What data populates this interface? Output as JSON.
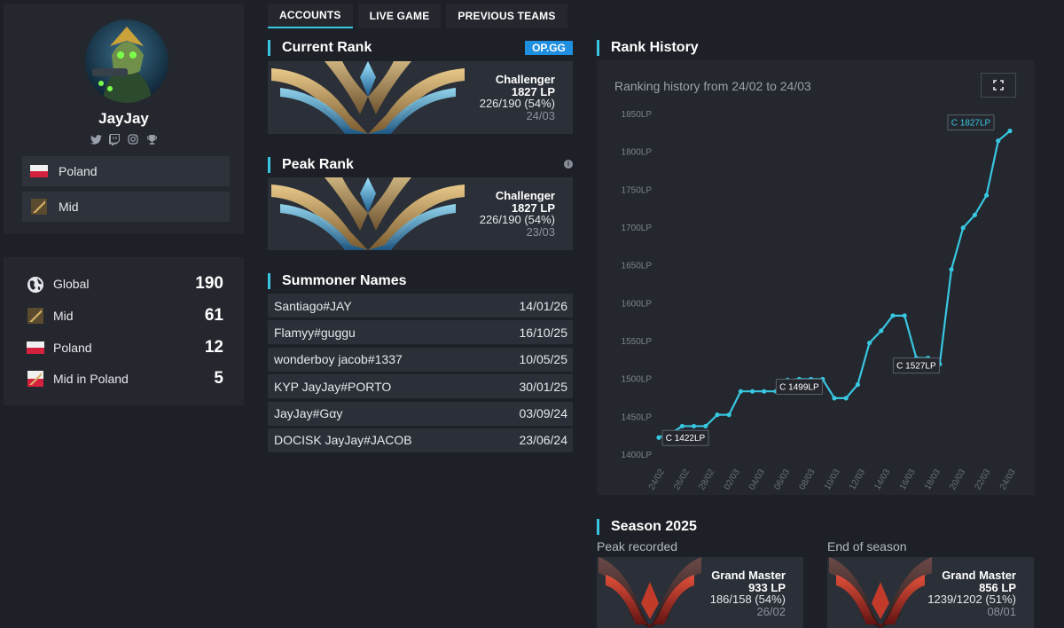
{
  "profile": {
    "name": "JayJay",
    "socials": [
      "twitter-icon",
      "twitch-icon",
      "instagram-icon",
      "trophy-icon"
    ],
    "country": "Poland",
    "role": "Mid"
  },
  "ladder": [
    {
      "label": "Global",
      "value": "190",
      "icon": "globe-icon"
    },
    {
      "label": "Mid",
      "value": "61",
      "icon": "mid-role-icon"
    },
    {
      "label": "Poland",
      "value": "12",
      "icon": "poland-flag-icon"
    },
    {
      "label": "Mid in Poland",
      "value": "5",
      "icon": "mid-poland-icon"
    }
  ],
  "tabs": [
    {
      "label": "ACCOUNTS",
      "active": true
    },
    {
      "label": "LIVE GAME",
      "active": false
    },
    {
      "label": "PREVIOUS TEAMS",
      "active": false
    }
  ],
  "current_rank": {
    "title": "Current Rank",
    "badge": "OP.GG",
    "tier": "Challenger",
    "lp": "1827 LP",
    "winloss": "226/190 (54%)",
    "date": "24/03"
  },
  "peak_rank": {
    "title": "Peak Rank",
    "tier": "Challenger",
    "lp": "1827 LP",
    "winloss": "226/190 (54%)",
    "date": "23/03"
  },
  "summoner_names": {
    "title": "Summoner Names",
    "rows": [
      {
        "name": "Santiago#JAY",
        "date": "14/01/26"
      },
      {
        "name": "Flamyy#guggu",
        "date": "16/10/25"
      },
      {
        "name": "wonderboy jacob#1337",
        "date": "10/05/25"
      },
      {
        "name": "KYP JayJay#PORTO",
        "date": "30/01/25"
      },
      {
        "name": "JayJay#Gαy",
        "date": "03/09/24"
      },
      {
        "name": "DOCISK JayJay#JACOB",
        "date": "23/06/24"
      }
    ]
  },
  "rank_history": {
    "title": "Rank History",
    "caption": "Ranking history from 24/02 to 24/03"
  },
  "chart_data": {
    "type": "line",
    "title": "",
    "xlabel": "",
    "ylabel": "",
    "ylim": [
      1400,
      1850
    ],
    "y_ticks": [
      "1850LP",
      "1800LP",
      "1750LP",
      "1700LP",
      "1650LP",
      "1600LP",
      "1550LP",
      "1500LP",
      "1450LP",
      "1400LP"
    ],
    "x_ticks": [
      "24/02",
      "26/02",
      "28/02",
      "02/03",
      "04/03",
      "06/03",
      "08/03",
      "10/03",
      "12/03",
      "14/03",
      "16/03",
      "18/03",
      "20/03",
      "22/03",
      "24/03"
    ],
    "x_dates": [
      "24/02",
      "24/02",
      "25/02",
      "26/02",
      "27/02",
      "28/02",
      "29/02",
      "01/03",
      "02/03",
      "03/03",
      "04/03",
      "05/03",
      "06/03",
      "07/03",
      "08/03",
      "09/03",
      "10/03",
      "11/03",
      "12/03",
      "13/03",
      "14/03",
      "15/03",
      "16/03",
      "17/03",
      "18/03",
      "19/03",
      "20/03",
      "21/03",
      "22/03",
      "23/03",
      "24/03"
    ],
    "values": [
      1422,
      1427,
      1437,
      1437,
      1437,
      1452,
      1452,
      1483,
      1483,
      1483,
      1483,
      1498,
      1499,
      1499,
      1499,
      1474,
      1474,
      1492,
      1547,
      1563,
      1583,
      1583,
      1527,
      1527,
      1519,
      1644,
      1699,
      1716,
      1742,
      1814,
      1827
    ],
    "annotations": [
      {
        "x": "24/02",
        "y": 1422,
        "label": "C 1422LP"
      },
      {
        "x": "06/03",
        "y": 1499,
        "label": "C 1499LP"
      },
      {
        "x": "17/03",
        "y": 1527,
        "label": "C 1527LP"
      },
      {
        "x": "24/03",
        "y": 1827,
        "label": "C 1827LP"
      }
    ],
    "color": "#38c6e0",
    "grid": false
  },
  "season": {
    "title": "Season 2025",
    "peak": {
      "label": "Peak recorded",
      "tier": "Grand Master",
      "lp": "933 LP",
      "winloss": "186/158 (54%)",
      "date": "26/02"
    },
    "end": {
      "label": "End of season",
      "tier": "Grand Master",
      "lp": "856 LP",
      "winloss": "1239/1202 (51%)",
      "date": "08/01"
    }
  }
}
